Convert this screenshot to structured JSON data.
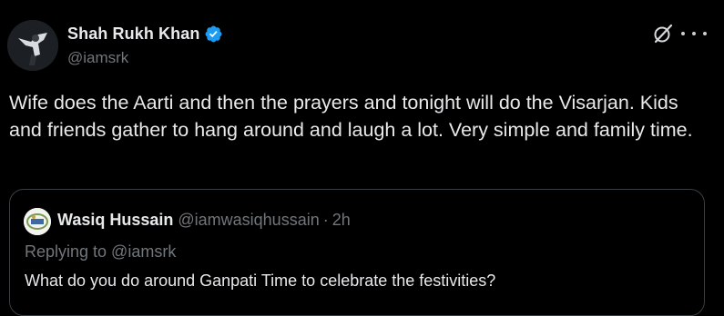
{
  "author": {
    "display_name": "Shah Rukh Khan",
    "handle": "@iamsrk",
    "verified_icon": "verified-badge-icon",
    "verified_color": "#1d9bf0"
  },
  "actions": {
    "grok_icon": "grok-icon",
    "more_icon": "more-icon"
  },
  "tweet": {
    "text": "Wife does the Aarti and then the prayers and tonight will do the Visarjan. Kids and friends gather to hang around and laugh a lot. Very simple and family time."
  },
  "quote": {
    "display_name": "Wasiq Hussain",
    "handle": "@iamwasiqhussain",
    "separator": "·",
    "time": "2h",
    "replying_to": "Replying to @iamsrk",
    "text": "What do you do around Ganpati Time to celebrate the festivities?"
  },
  "colors": {
    "background": "#000000",
    "primary_text": "#e7e9ea",
    "secondary_text": "#71767b",
    "border": "#3a3f44"
  }
}
